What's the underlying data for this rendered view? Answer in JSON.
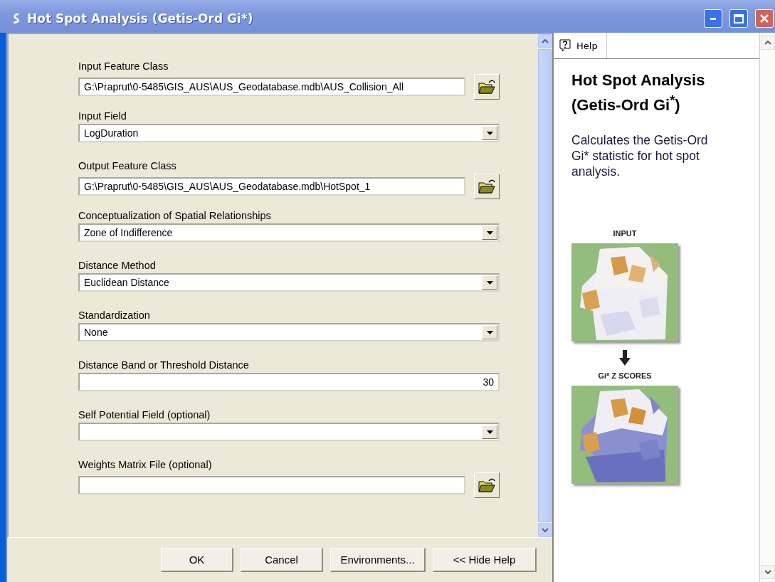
{
  "window": {
    "title": "Hot Spot Analysis (Getis-Ord Gi*)"
  },
  "parameters": [
    {
      "label": "Input Feature Class",
      "kind": "file",
      "value": "G:\\Praprut\\0-5485\\GIS_AUS\\AUS_Geodatabase.mdb\\AUS_Collision_All"
    },
    {
      "label": "Input Field",
      "kind": "dropdown",
      "value": "LogDuration"
    },
    {
      "label": "Output Feature Class",
      "kind": "file",
      "value": "G:\\Praprut\\0-5485\\GIS_AUS\\AUS_Geodatabase.mdb\\HotSpot_1"
    },
    {
      "label": "Conceptualization of Spatial Relationships",
      "kind": "dropdown",
      "value": "Zone of Indifference"
    },
    {
      "label": "Distance Method",
      "kind": "dropdown",
      "value": "Euclidean Distance"
    },
    {
      "label": "Standardization",
      "kind": "dropdown",
      "value": "None"
    },
    {
      "label": "Distance Band or Threshold Distance",
      "kind": "number",
      "value": "30"
    },
    {
      "label": "Self Potential Field (optional)",
      "kind": "dropdown"
    },
    {
      "label": "Weights Matrix File (optional)",
      "kind": "file"
    }
  ],
  "buttons": [
    "OK",
    "Cancel",
    "Environments...",
    "<< Hide Help"
  ],
  "help": {
    "tab": "Help",
    "title": "Hot Spot Analysis (Getis-Ord Gi$^{*}$)",
    "description": "Calculates the Getis-Ord Gi* statistic for hot spot analysis.",
    "figures": [
      {
        "caption": "INPUT",
        "kind": "picture"
      },
      {
        "caption": "Gi* Z SCORES",
        "kind": "picture"
      }
    ]
  }
}
